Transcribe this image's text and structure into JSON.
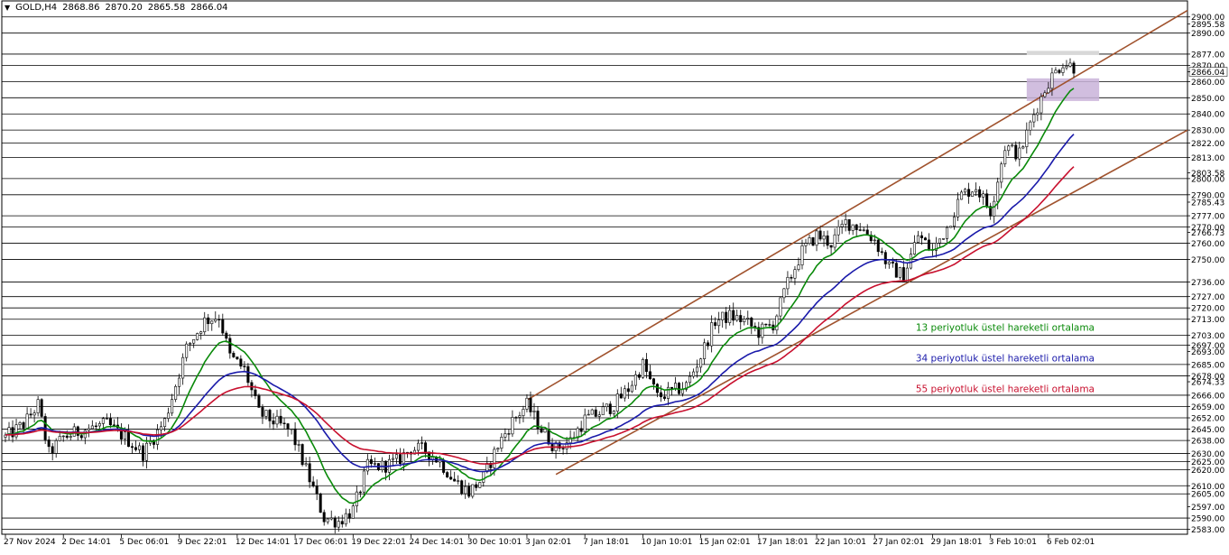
{
  "header": {
    "symbol": "GOLD,H4",
    "open": "2868.86",
    "high": "2870.20",
    "low": "2865.58",
    "close": "2866.04"
  },
  "chart_data": {
    "type": "line",
    "title": "",
    "xlabel": "",
    "ylabel": "",
    "ylim": [
      2580,
      2906
    ],
    "grid": false,
    "price_levels": [
      2900.0,
      2890.0,
      2877.0,
      2870.0,
      2860.0,
      2850.0,
      2840.0,
      2830.0,
      2822.0,
      2813.0,
      2800.0,
      2790.0,
      2777.0,
      2770.0,
      2760.0,
      2750.0,
      2736.0,
      2727.0,
      2720.0,
      2713.0,
      2703.0,
      2697.0,
      2685.0,
      2678.0,
      2666.0,
      2659.0,
      2652.0,
      2645.0,
      2638.0,
      2630.0,
      2625.0,
      2620.0,
      2610.0,
      2605.0,
      2590.0,
      2583.0
    ],
    "y_tick_labels": [
      {
        "value": 2900.0,
        "label": "2900.00"
      },
      {
        "value": 2895.58,
        "label": "2895.58"
      },
      {
        "value": 2890.0,
        "label": "2890.00"
      },
      {
        "value": 2877.0,
        "label": "2877.00"
      },
      {
        "value": 2870.0,
        "label": "2870.00"
      },
      {
        "value": 2866.04,
        "label": "2866.04"
      },
      {
        "value": 2860.0,
        "label": "2860.00"
      },
      {
        "value": 2850.0,
        "label": "2850.00"
      },
      {
        "value": 2840.0,
        "label": "2840.00"
      },
      {
        "value": 2830.0,
        "label": "2830.00"
      },
      {
        "value": 2822.0,
        "label": "2822.00"
      },
      {
        "value": 2813.0,
        "label": "2813.00"
      },
      {
        "value": 2803.58,
        "label": "2803.58"
      },
      {
        "value": 2800.0,
        "label": "2800.00"
      },
      {
        "value": 2790.0,
        "label": "2790.00"
      },
      {
        "value": 2785.43,
        "label": "2785.43"
      },
      {
        "value": 2777.0,
        "label": "2777.00"
      },
      {
        "value": 2770.0,
        "label": "2770.00"
      },
      {
        "value": 2766.73,
        "label": "2766.73"
      },
      {
        "value": 2760.0,
        "label": "2760.00"
      },
      {
        "value": 2750.0,
        "label": "2750.00"
      },
      {
        "value": 2736.0,
        "label": "2736.00"
      },
      {
        "value": 2727.0,
        "label": "2727.00"
      },
      {
        "value": 2720.0,
        "label": "2720.00"
      },
      {
        "value": 2713.0,
        "label": "2713.00"
      },
      {
        "value": 2703.0,
        "label": "2703.00"
      },
      {
        "value": 2697.0,
        "label": "2697.00"
      },
      {
        "value": 2693.0,
        "label": "2693.00"
      },
      {
        "value": 2685.0,
        "label": "2685.00"
      },
      {
        "value": 2678.0,
        "label": "2678.00"
      },
      {
        "value": 2674.33,
        "label": "2674.33"
      },
      {
        "value": 2666.0,
        "label": "2666.00"
      },
      {
        "value": 2659.0,
        "label": "2659.00"
      },
      {
        "value": 2652.0,
        "label": "2652.00"
      },
      {
        "value": 2645.0,
        "label": "2645.00"
      },
      {
        "value": 2638.0,
        "label": "2638.00"
      },
      {
        "value": 2630.0,
        "label": "2630.00"
      },
      {
        "value": 2625.0,
        "label": "2625.00"
      },
      {
        "value": 2620.0,
        "label": "2620.00"
      },
      {
        "value": 2610.0,
        "label": "2610.00"
      },
      {
        "value": 2605.0,
        "label": "2605.00"
      },
      {
        "value": 2597.0,
        "label": "2597.00"
      },
      {
        "value": 2590.0,
        "label": "2590.00"
      },
      {
        "value": 2583.0,
        "label": "2583.00"
      }
    ],
    "x_labels": [
      "27 Nov 2024",
      "2 Dec 14:01",
      "5 Dec 06:01",
      "9 Dec 22:01",
      "12 Dec 14:01",
      "17 Dec 06:01",
      "19 Dec 22:01",
      "24 Dec 14:01",
      "30 Dec 10:01",
      "3 Jan 02:01",
      "7 Jan 18:01",
      "10 Jan 10:01",
      "15 Jan 02:01",
      "17 Jan 18:01",
      "22 Jan 10:01",
      "27 Jan 02:01",
      "29 Jan 18:01",
      "3 Feb 10:01",
      "6 Feb 02:01"
    ],
    "x_index": [
      0,
      16,
      32,
      48,
      64,
      80,
      96,
      112,
      128,
      144,
      160,
      176,
      192,
      208,
      224,
      240,
      256,
      272,
      288
    ],
    "bars_count": 296,
    "price_anchors": [
      [
        0,
        2640
      ],
      [
        5,
        2648
      ],
      [
        9,
        2660
      ],
      [
        12,
        2630
      ],
      [
        16,
        2640
      ],
      [
        22,
        2645
      ],
      [
        28,
        2648
      ],
      [
        33,
        2640
      ],
      [
        38,
        2630
      ],
      [
        44,
        2650
      ],
      [
        50,
        2695
      ],
      [
        55,
        2712
      ],
      [
        59,
        2715
      ],
      [
        62,
        2690
      ],
      [
        66,
        2682
      ],
      [
        70,
        2655
      ],
      [
        74,
        2650
      ],
      [
        79,
        2643
      ],
      [
        83,
        2620
      ],
      [
        88,
        2590
      ],
      [
        92,
        2588
      ],
      [
        96,
        2595
      ],
      [
        100,
        2622
      ],
      [
        104,
        2622
      ],
      [
        108,
        2625
      ],
      [
        112,
        2633
      ],
      [
        116,
        2632
      ],
      [
        120,
        2625
      ],
      [
        124,
        2613
      ],
      [
        128,
        2606
      ],
      [
        132,
        2615
      ],
      [
        136,
        2635
      ],
      [
        140,
        2650
      ],
      [
        144,
        2660
      ],
      [
        148,
        2645
      ],
      [
        152,
        2633
      ],
      [
        156,
        2638
      ],
      [
        160,
        2651
      ],
      [
        164,
        2655
      ],
      [
        168,
        2660
      ],
      [
        172,
        2670
      ],
      [
        176,
        2685
      ],
      [
        180,
        2665
      ],
      [
        184,
        2668
      ],
      [
        188,
        2672
      ],
      [
        192,
        2690
      ],
      [
        196,
        2712
      ],
      [
        200,
        2715
      ],
      [
        204,
        2712
      ],
      [
        208,
        2705
      ],
      [
        212,
        2710
      ],
      [
        216,
        2735
      ],
      [
        220,
        2755
      ],
      [
        224,
        2765
      ],
      [
        228,
        2760
      ],
      [
        232,
        2773
      ],
      [
        236,
        2770
      ],
      [
        240,
        2762
      ],
      [
        244,
        2745
      ],
      [
        248,
        2740
      ],
      [
        252,
        2765
      ],
      [
        256,
        2755
      ],
      [
        260,
        2770
      ],
      [
        264,
        2790
      ],
      [
        268,
        2795
      ],
      [
        272,
        2780
      ],
      [
        276,
        2820
      ],
      [
        280,
        2815
      ],
      [
        284,
        2840
      ],
      [
        288,
        2860
      ],
      [
        292,
        2872
      ],
      [
        296,
        2868
      ],
      [
        300,
        2862
      ],
      [
        304,
        2846
      ],
      [
        308,
        2860
      ],
      [
        312,
        2866
      ]
    ],
    "channel_upper": [
      [
        144,
        2663
      ],
      [
        330,
        2904
      ]
    ],
    "channel_lower": [
      [
        152,
        2617
      ],
      [
        330,
        2830
      ]
    ],
    "resistance_zone": {
      "x_from": 282,
      "x_to": 302,
      "y_from": 2848,
      "y_to": 2862
    },
    "top_zone": {
      "x_from": 282,
      "x_to": 302,
      "y_from": 2877,
      "y_to": 2879
    },
    "current_price": 2866.04,
    "series": [
      {
        "name": "13 periyotluk üstel hareketli ortalama",
        "period": 13,
        "color": "#0a8a0a"
      },
      {
        "name": "34 periyotluk üstel hareketli ortalama",
        "period": 34,
        "color": "#1a1aaa"
      },
      {
        "name": "55 periyotluk üstel hareketli ortalama",
        "period": 55,
        "color": "#c8102e"
      }
    ],
    "colors": {
      "candle_up": "#000000",
      "candle_down": "#000000",
      "h_lines": "#000000",
      "channel": "#a0522d",
      "zone_fill": "#c9b3d9",
      "top_zone_fill": "#d8d8d8"
    }
  }
}
